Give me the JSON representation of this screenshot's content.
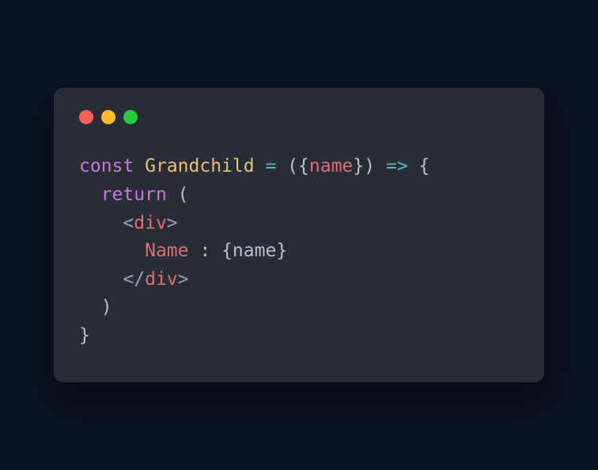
{
  "colors": {
    "background": "#0a1321",
    "window": "#282c34",
    "red": "#ff5f56",
    "yellow": "#ffbd2e",
    "green": "#27c93f",
    "keyword": "#c678dd",
    "function": "#e5c07b",
    "operator": "#56b6c2",
    "variable": "#e06c75",
    "default": "#b8c0cb"
  },
  "code": {
    "line1": {
      "const": "const",
      "sp1": " ",
      "fname": "Grandchild",
      "sp2": " ",
      "eq": "=",
      "sp3": " ",
      "lparen": "(",
      "lbrace": "{",
      "param": "name",
      "rbrace": "}",
      "rparen": ")",
      "sp4": " ",
      "arrow": "=>",
      "sp5": " ",
      "obrace": "{"
    },
    "line2": {
      "indent": "  ",
      "return": "return",
      "sp": " ",
      "lparen": "("
    },
    "line3": {
      "indent": "    ",
      "lt": "<",
      "tag": "div",
      "gt": ">"
    },
    "line4": {
      "indent": "      ",
      "text": "Name",
      "sp": " ",
      "colon": ":",
      "sp2": " ",
      "lbrace": "{",
      "var": "name",
      "rbrace": "}"
    },
    "line5": {
      "indent": "    ",
      "lt": "</",
      "tag": "div",
      "gt": ">"
    },
    "line6": {
      "indent": "  ",
      "rparen": ")"
    },
    "line7": {
      "rbrace": "}"
    }
  }
}
